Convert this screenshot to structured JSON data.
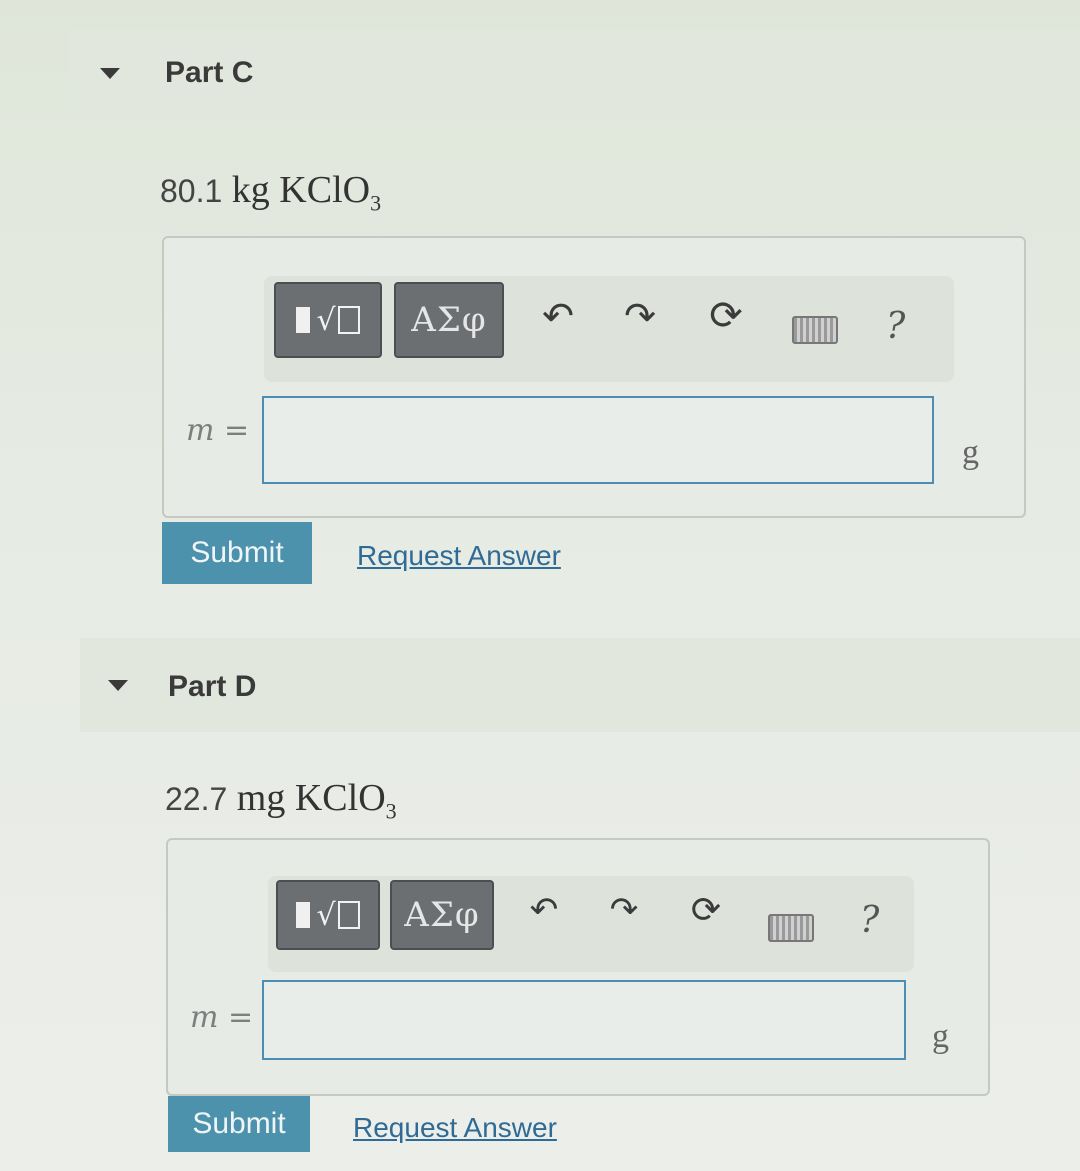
{
  "parts": [
    {
      "title": "Part C",
      "question": {
        "number": "80.1",
        "unit": "kg",
        "formula_main": "KClO",
        "formula_sub": "3"
      },
      "toolbar": {
        "symbols_label": "ΑΣφ",
        "help_label": "?"
      },
      "variable_label": "m =",
      "input_value": "",
      "answer_unit": "g",
      "submit_label": "Submit",
      "request_label": "Request Answer"
    },
    {
      "title": "Part D",
      "question": {
        "number": "22.7",
        "unit": "mg",
        "formula_main": "KClO",
        "formula_sub": "3"
      },
      "toolbar": {
        "symbols_label": "ΑΣφ",
        "help_label": "?"
      },
      "variable_label": "m =",
      "input_value": "",
      "answer_unit": "g",
      "submit_label": "Submit",
      "request_label": "Request Answer"
    }
  ],
  "icons": {
    "collapse": "caret-down-icon",
    "templates": "templates-icon",
    "undo": "undo-icon",
    "redo": "redo-icon",
    "reset": "reset-icon",
    "keyboard": "keyboard-icon",
    "help": "help-icon"
  },
  "colors": {
    "submit_bg": "#4c92ad",
    "link": "#2f6b95",
    "input_border": "#4a8fb3",
    "toolbar_btn": "#6c6f72"
  }
}
